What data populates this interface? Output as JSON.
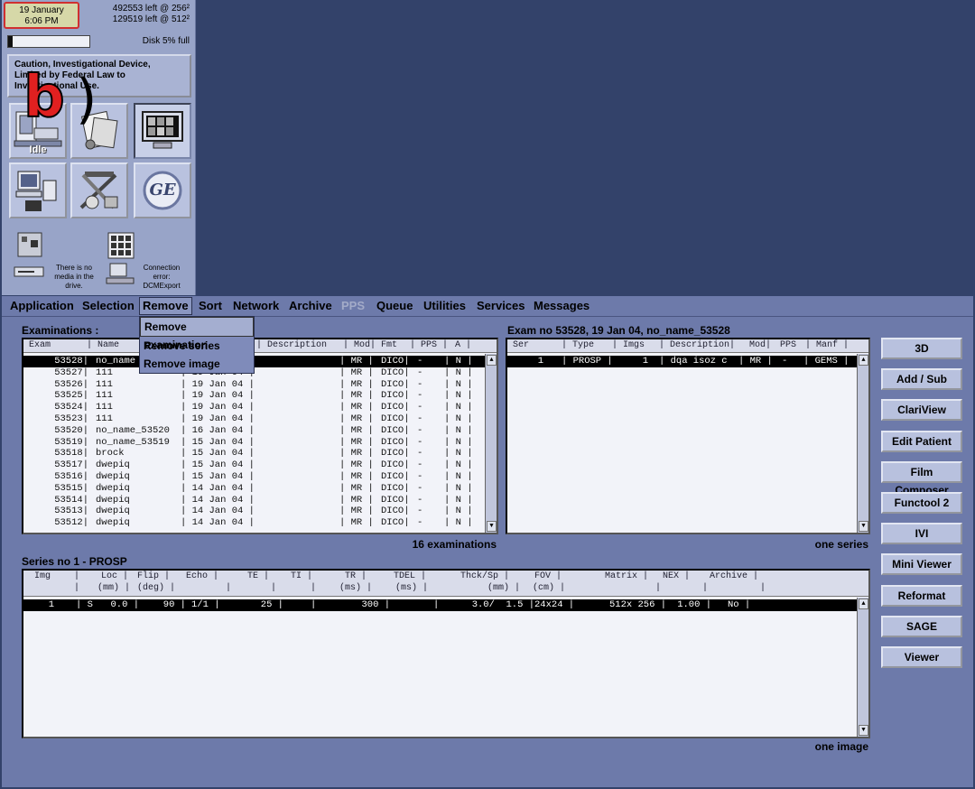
{
  "status": {
    "date": "19 January",
    "time": "6:06 PM",
    "disk_left_256": "492553 left @ 256²",
    "disk_left_512": "129519 left @ 512²",
    "disk_label": "Disk  5% full",
    "disk_fill_fraction": 0.05,
    "caution": "Caution, Investigational Device, Limited by Federal Law to Investigational Use.",
    "idle_label": "Idle",
    "ge_label": "GE",
    "media_text": "There is no media in the drive.",
    "connection_text": "Connection error: DCMExport",
    "annotation_letter": "b",
    "annotation_paren": ")"
  },
  "menu": {
    "items": [
      "Application",
      "Selection",
      "Remove",
      "Sort",
      "Network",
      "Archive",
      "PPS",
      "Queue",
      "Utilities",
      "Services",
      "Messages"
    ],
    "active": "Remove",
    "disabled": [
      "PPS"
    ],
    "remove_menu": [
      "Remove examination",
      "Remove series",
      "Remove image"
    ]
  },
  "examinations": {
    "title": "Examinations :",
    "headers": [
      "Exam",
      "| Name",
      "| Description",
      "| Mod|",
      "Fmt",
      "| PPS |",
      "A |"
    ],
    "rows": [
      {
        "exam": "53528|",
        "name": "no_name",
        "date": "",
        "mod": "| MR |",
        "fmt": "DICO|",
        "pps": "-",
        "a": "| N |",
        "selected": true
      },
      {
        "exam": "53527|",
        "name": "111",
        "date": "| 19 Jan 04 |",
        "mod": "| MR |",
        "fmt": "DICO|",
        "pps": "-",
        "a": "| N |"
      },
      {
        "exam": "53526|",
        "name": "111",
        "date": "| 19 Jan 04 |",
        "mod": "| MR |",
        "fmt": "DICO|",
        "pps": "-",
        "a": "| N |"
      },
      {
        "exam": "53525|",
        "name": "111",
        "date": "| 19 Jan 04 |",
        "mod": "| MR |",
        "fmt": "DICO|",
        "pps": "-",
        "a": "| N |"
      },
      {
        "exam": "53524|",
        "name": "111",
        "date": "| 19 Jan 04 |",
        "mod": "| MR |",
        "fmt": "DICO|",
        "pps": "-",
        "a": "| N |"
      },
      {
        "exam": "53523|",
        "name": "111",
        "date": "| 19 Jan 04 |",
        "mod": "| MR |",
        "fmt": "DICO|",
        "pps": "-",
        "a": "| N |"
      },
      {
        "exam": "53520|",
        "name": "no_name_53520",
        "date": "| 16 Jan 04 |",
        "mod": "| MR |",
        "fmt": "DICO|",
        "pps": "-",
        "a": "| N |"
      },
      {
        "exam": "53519|",
        "name": "no_name_53519",
        "date": "| 15 Jan 04 |",
        "mod": "| MR |",
        "fmt": "DICO|",
        "pps": "-",
        "a": "| N |"
      },
      {
        "exam": "53518|",
        "name": "brock",
        "date": "| 15 Jan 04 |",
        "mod": "| MR |",
        "fmt": "DICO|",
        "pps": "-",
        "a": "| N |"
      },
      {
        "exam": "53517|",
        "name": "dwepiq",
        "date": "| 15 Jan 04 |",
        "mod": "| MR |",
        "fmt": "DICO|",
        "pps": "-",
        "a": "| N |"
      },
      {
        "exam": "53516|",
        "name": "dwepiq",
        "date": "| 15 Jan 04 |",
        "mod": "| MR |",
        "fmt": "DICO|",
        "pps": "-",
        "a": "| N |"
      },
      {
        "exam": "53515|",
        "name": "dwepiq",
        "date": "| 14 Jan 04 |",
        "mod": "| MR |",
        "fmt": "DICO|",
        "pps": "-",
        "a": "| N |"
      },
      {
        "exam": "53514|",
        "name": "dwepiq",
        "date": "| 14 Jan 04 |",
        "mod": "| MR |",
        "fmt": "DICO|",
        "pps": "-",
        "a": "| N |"
      },
      {
        "exam": "53513|",
        "name": "dwepiq",
        "date": "| 14 Jan 04 |",
        "mod": "| MR |",
        "fmt": "DICO|",
        "pps": "-",
        "a": "| N |"
      },
      {
        "exam": "53512|",
        "name": "dwepiq",
        "date": "| 14 Jan 04 |",
        "mod": "| MR |",
        "fmt": "DICO|",
        "pps": "-",
        "a": "| N |"
      }
    ],
    "count_label": "16 examinations"
  },
  "exam_series": {
    "title": "Exam no 53528,  19 Jan 04, no_name_53528",
    "headers": [
      "Ser",
      "| Type",
      "| Imgs",
      "| Description|",
      "Mod|",
      "PPS",
      "| Manf |"
    ],
    "rows": [
      {
        "ser": "1",
        "type": "| PROSP |",
        "imgs": "1",
        "desc": "| dqa isoz c",
        "mod": "| MR |",
        "pps": "-",
        "manf": "| GEMS |",
        "selected": true
      }
    ],
    "count_label": "one series"
  },
  "series_images": {
    "title": "Series no 1 - PROSP",
    "headers_top": [
      "Img",
      "|",
      "Loc |",
      "Flip |",
      "Echo |",
      "TE |",
      "TI |",
      "TR |",
      "TDEL |",
      "Thck/Sp |",
      "FOV |",
      "Matrix |",
      "NEX |",
      "Archive |"
    ],
    "headers_units": [
      "|",
      "(mm) |",
      "(deg) |",
      "|",
      "|",
      "|",
      "(ms) |",
      "(ms) |",
      "(mm) |",
      "(cm) |",
      "|",
      "|",
      "|"
    ],
    "rows": [
      {
        "img": "1",
        "s": "| S",
        "loc": "0.0 |",
        "flip": "90 |",
        "echo": "1/1 |",
        "te": "25 |",
        "ti": "|",
        "tr": "300 |",
        "tdel": "|",
        "thck": "3.0/  1.5 |",
        "fov": "24x24 |",
        "matrix": "512x 256 |",
        "nex": "1.00 |",
        "archive": "No |",
        "selected": true
      }
    ],
    "count_label": "one image"
  },
  "side_buttons": [
    "3D",
    "Add / Sub",
    "ClariView",
    "Edit Patient",
    "Film Composer",
    "Functool 2",
    "IVI",
    "Mini Viewer",
    "Reformat",
    "SAGE",
    "Viewer"
  ]
}
